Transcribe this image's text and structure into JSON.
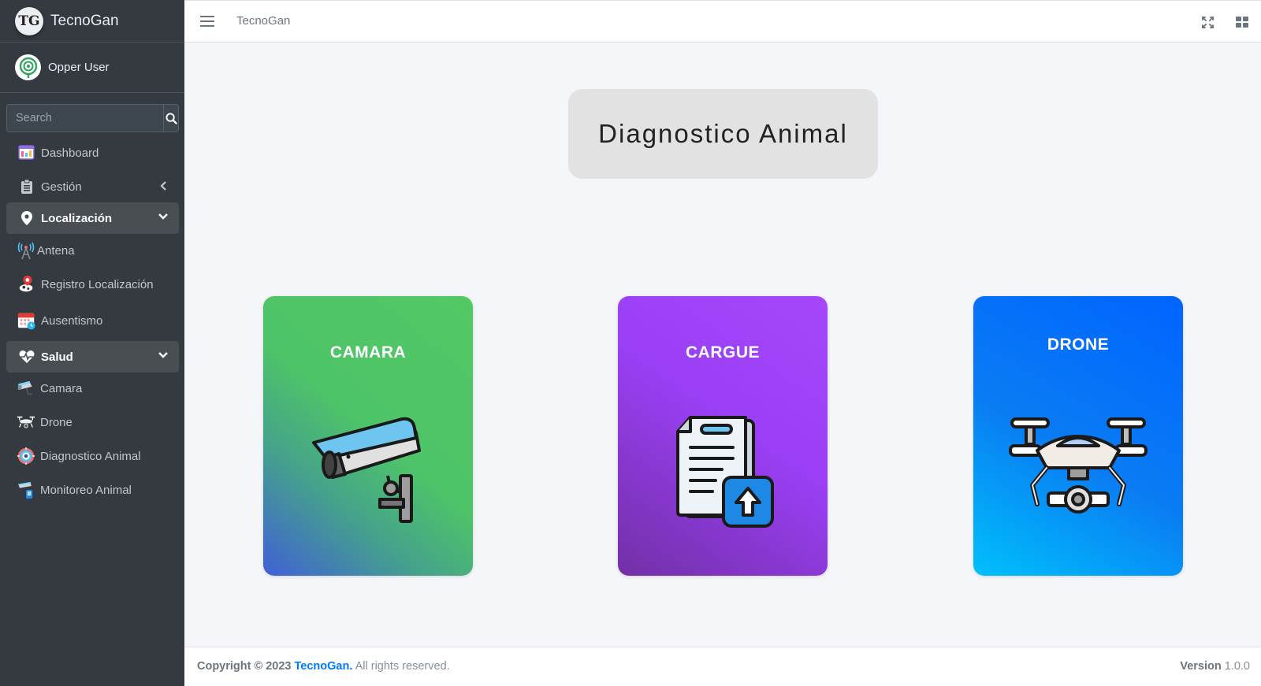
{
  "brand": {
    "logo_text": "TG",
    "name": "TecnoGan"
  },
  "user": {
    "name": "Opper User"
  },
  "search": {
    "placeholder": "Search"
  },
  "sidebar": {
    "items": [
      {
        "label": "Dashboard",
        "icon": "dashboard-icon"
      },
      {
        "label": "Gestión",
        "icon": "clipboard-icon",
        "state": "collapsed"
      },
      {
        "label": "Localización",
        "icon": "map-marker-icon",
        "state": "expanded"
      },
      {
        "label": "Antena",
        "icon": "antenna-icon"
      },
      {
        "label": "Registro Localización",
        "icon": "cow-location-icon"
      },
      {
        "label": "Ausentismo",
        "icon": "calendar-icon"
      },
      {
        "label": "Salud",
        "icon": "heartbeat-icon",
        "state": "expanded"
      },
      {
        "label": "Camara",
        "icon": "security-camera-icon"
      },
      {
        "label": "Drone",
        "icon": "drone-icon"
      },
      {
        "label": "Diagnostico Animal",
        "icon": "diagnostic-icon"
      },
      {
        "label": "Monitoreo Animal",
        "icon": "monitor-icon"
      }
    ]
  },
  "header": {
    "breadcrumb": "TecnoGan"
  },
  "main": {
    "title": "Diagnostico Animal",
    "cards": [
      {
        "label": "CAMARA",
        "icon": "security-camera-icon",
        "accent": "#4ec468"
      },
      {
        "label": "CARGUE",
        "icon": "document-upload-icon",
        "accent": "#9a3ff5"
      },
      {
        "label": "DRONE",
        "icon": "drone-icon",
        "accent": "#0a7cf3"
      }
    ]
  },
  "footer": {
    "copyright": "Copyright © 2023",
    "company": "TecnoGan.",
    "rights": "All rights reserved.",
    "version_label": "Version",
    "version": "1.0.0"
  }
}
